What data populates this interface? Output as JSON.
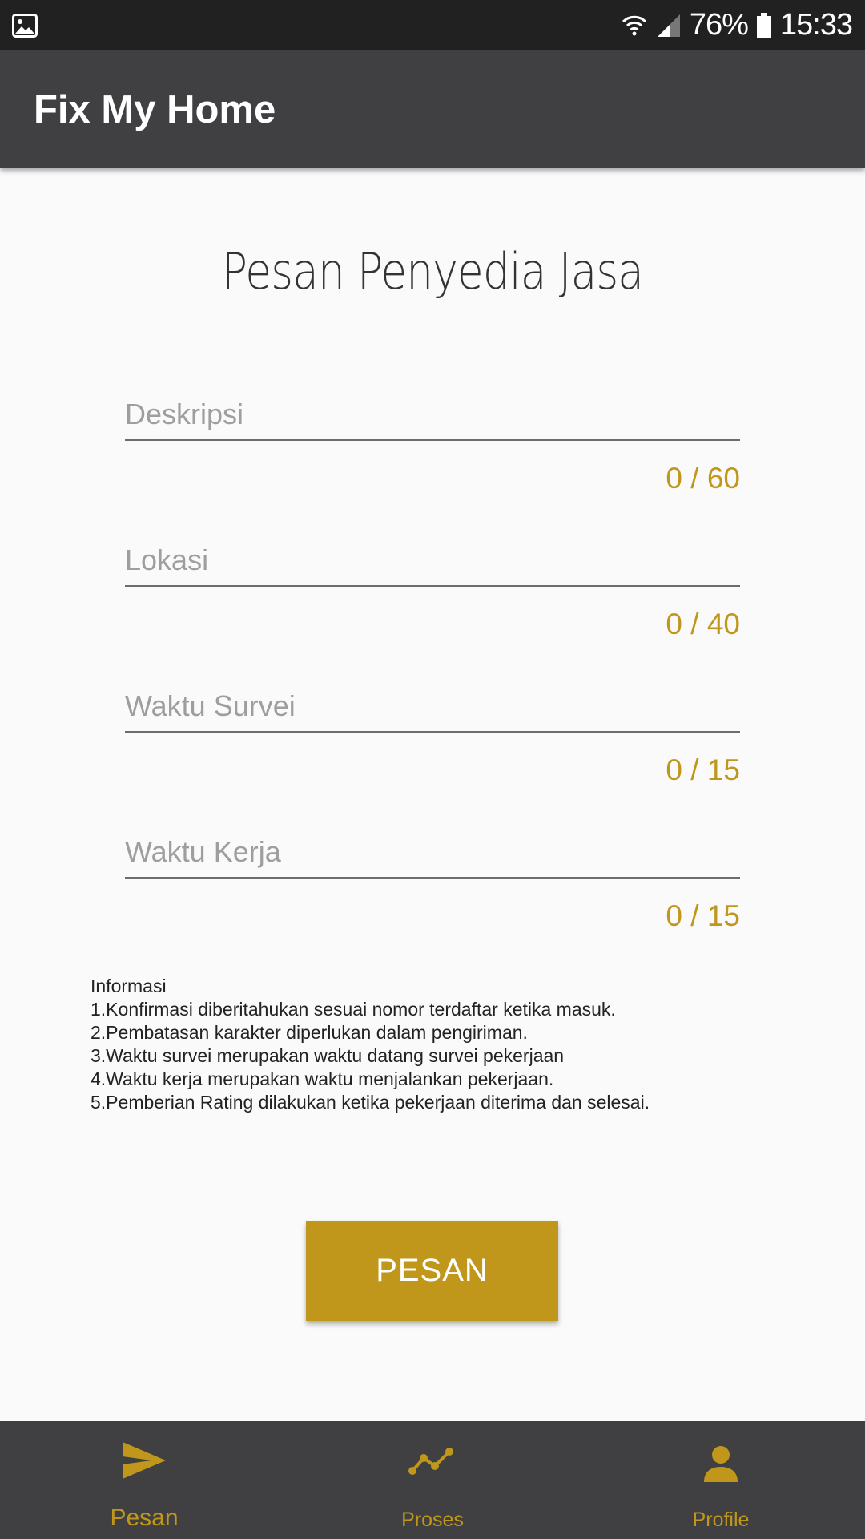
{
  "status_bar": {
    "battery_percent": "76%",
    "time": "15:33",
    "icons": [
      "gallery-icon",
      "wifi-icon",
      "signal-icon",
      "battery-icon"
    ]
  },
  "app_bar": {
    "title": "Fix My Home"
  },
  "page": {
    "title": "Pesan Penyedia Jasa"
  },
  "form": {
    "fields": [
      {
        "placeholder": "Deskripsi",
        "value": "",
        "counter": "0 / 60"
      },
      {
        "placeholder": "Lokasi",
        "value": "",
        "counter": "0 / 40"
      },
      {
        "placeholder": "Waktu Survei",
        "value": "",
        "counter": "0 / 15"
      },
      {
        "placeholder": "Waktu Kerja",
        "value": "",
        "counter": "0 / 15"
      }
    ]
  },
  "info": {
    "heading": "Informasi",
    "lines": [
      "1.Konfirmasi diberitahukan sesuai nomor terdaftar ketika masuk.",
      "2.Pembatasan karakter diperlukan dalam pengiriman.",
      "3.Waktu survei merupakan waktu datang survei pekerjaan",
      "4.Waktu kerja merupakan waktu menjalankan pekerjaan.",
      "5.Pemberian Rating dilakukan ketika pekerjaan diterima dan selesai."
    ]
  },
  "submit_button": {
    "label": "PESAN"
  },
  "bottom_nav": {
    "items": [
      {
        "label": "Pesan",
        "icon": "send-icon",
        "active": true
      },
      {
        "label": "Proses",
        "icon": "timeline-icon",
        "active": false
      },
      {
        "label": "Profile",
        "icon": "person-icon",
        "active": false
      }
    ]
  },
  "colors": {
    "accent": "#c0971b",
    "app_bar": "#404042",
    "status_bar": "#212121",
    "background": "#fafafa"
  }
}
